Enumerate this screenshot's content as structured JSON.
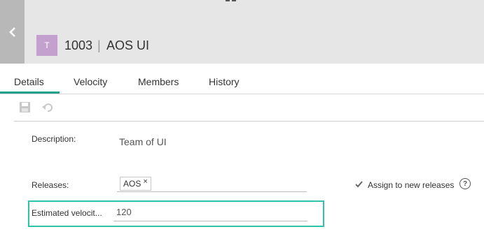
{
  "header": {
    "avatar_letter": "T",
    "team_id": "1003",
    "separator": "|",
    "team_name": "AOS UI"
  },
  "tabs": [
    {
      "label": "Details",
      "active": true
    },
    {
      "label": "Velocity",
      "active": false
    },
    {
      "label": "Members",
      "active": false
    },
    {
      "label": "History",
      "active": false
    }
  ],
  "toolbar": {
    "icons": [
      "save-icon",
      "revert-icon"
    ]
  },
  "form": {
    "description": {
      "label": "Description:",
      "value": "Team of UI"
    },
    "releases": {
      "label": "Releases:",
      "chips": [
        {
          "label": "AOS",
          "remove": "×"
        }
      ],
      "assign_label": "Assign to new releases"
    },
    "estimated_velocity": {
      "label": "Estimated velocit...",
      "value": "120"
    }
  },
  "colors": {
    "header_bg": "#e6e6e6",
    "avatar_bg": "#c3a0cd",
    "tab_accent": "#23a18e",
    "focus_border": "#2ec4a8"
  }
}
